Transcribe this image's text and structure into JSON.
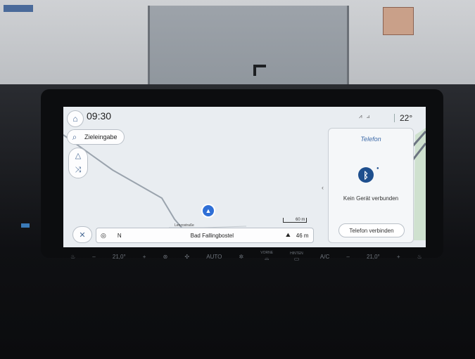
{
  "status": {
    "time": "09:30",
    "temperature": "22°"
  },
  "search": {
    "label": "Zieleingabe"
  },
  "phone": {
    "title": "Telefon",
    "no_device": "Kein Gerät verbunden",
    "connect_button": "Telefon verbinden"
  },
  "map": {
    "road_label": "Lenzostraße",
    "scale": "60 m"
  },
  "nav_bar": {
    "heading": "N",
    "location": "Bad Fallingbostel",
    "altitude": "46 m"
  },
  "climate": {
    "left_temp": "21,0°",
    "auto": "AUTO",
    "front_label": "VORNE",
    "rear_label": "HINTEN",
    "ac": "A/C",
    "right_temp": "21,0°"
  },
  "colors": {
    "accent": "#3d6aa8",
    "position_marker": "#2f6fd6",
    "screen_bg": "#e9edf1"
  }
}
